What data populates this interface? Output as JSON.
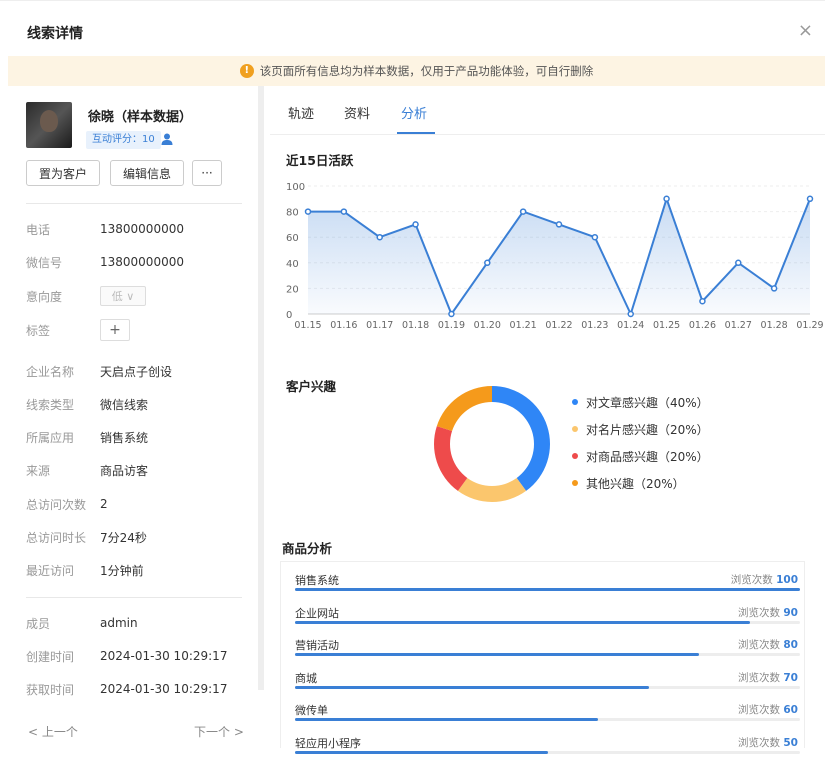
{
  "header": {
    "title": "线索详情",
    "close_symbol": "×"
  },
  "notice": {
    "text": "该页面所有信息均为样本数据，仅用于产品功能体验，可自行删除"
  },
  "profile": {
    "name": "徐晓（样本数据）",
    "score_label": "互动评分：10",
    "buttons": {
      "set_customer": "置为客户",
      "edit_info": "编辑信息",
      "more": "···"
    }
  },
  "fields": [
    {
      "key": "电话",
      "value": "13800000000"
    },
    {
      "key": "微信号",
      "value": "13800000000"
    },
    {
      "key": "意向度",
      "value": "低 ∨"
    },
    {
      "key": "标签",
      "value": "+"
    },
    {
      "key": "企业名称",
      "value": "天启点子创设"
    },
    {
      "key": "线索类型",
      "value": "微信线索"
    },
    {
      "key": "所属应用",
      "value": "销售系统"
    },
    {
      "key": "来源",
      "value": "商品访客"
    },
    {
      "key": "总访问次数",
      "value": "2"
    },
    {
      "key": "总访问时长",
      "value": "7分24秒"
    },
    {
      "key": "最近访问",
      "value": "1分钟前"
    }
  ],
  "meta_fields": [
    {
      "key": "成员",
      "value": "admin"
    },
    {
      "key": "创建时间",
      "value": "2024-01-30 10:29:17"
    },
    {
      "key": "获取时间",
      "value": "2024-01-30 10:29:17"
    }
  ],
  "pager": {
    "prev": "< 上一个",
    "next": "下一个 >"
  },
  "tabs": [
    {
      "label": "轨迹"
    },
    {
      "label": "资料"
    },
    {
      "label": "分析",
      "active": true
    }
  ],
  "sections": {
    "activity": "近15日活跃",
    "interest": "客户兴趣",
    "product": "商品分析"
  },
  "chart_data": [
    {
      "type": "area",
      "title": "近15日活跃",
      "categories": [
        "01.15",
        "01.16",
        "01.17",
        "01.18",
        "01.19",
        "01.20",
        "01.21",
        "01.22",
        "01.23",
        "01.24",
        "01.25",
        "01.26",
        "01.27",
        "01.28",
        "01.29"
      ],
      "values": [
        80,
        80,
        60,
        70,
        0,
        40,
        80,
        70,
        60,
        0,
        90,
        10,
        40,
        20,
        90
      ],
      "yticks": [
        0,
        20,
        40,
        60,
        80,
        100
      ],
      "ylim": [
        0,
        100
      ],
      "color": "#3a7fd5",
      "grid": true
    },
    {
      "type": "pie",
      "title": "客户兴趣",
      "donut": true,
      "legend_position": "right",
      "slices": [
        {
          "label": "对文章感兴趣（40%）",
          "value": 40,
          "color": "#2f86f6"
        },
        {
          "label": "对名片感兴趣（20%）",
          "value": 20,
          "color": "#fbc66d"
        },
        {
          "label": "对商品感兴趣（20%）",
          "value": 20,
          "color": "#ee4b4b"
        },
        {
          "label": "其他兴趣（20%）",
          "value": 20,
          "color": "#f59a1b"
        }
      ]
    },
    {
      "type": "bar",
      "title": "商品分析",
      "max": 100,
      "value_prefix": "浏览次数",
      "rows": [
        {
          "name": "销售系统",
          "value": 100
        },
        {
          "name": "企业网站",
          "value": 90
        },
        {
          "name": "营销活动",
          "value": 80
        },
        {
          "name": "商城",
          "value": 70
        },
        {
          "name": "微传单",
          "value": 60
        },
        {
          "name": "轻应用小程序",
          "value": 50
        }
      ]
    }
  ]
}
